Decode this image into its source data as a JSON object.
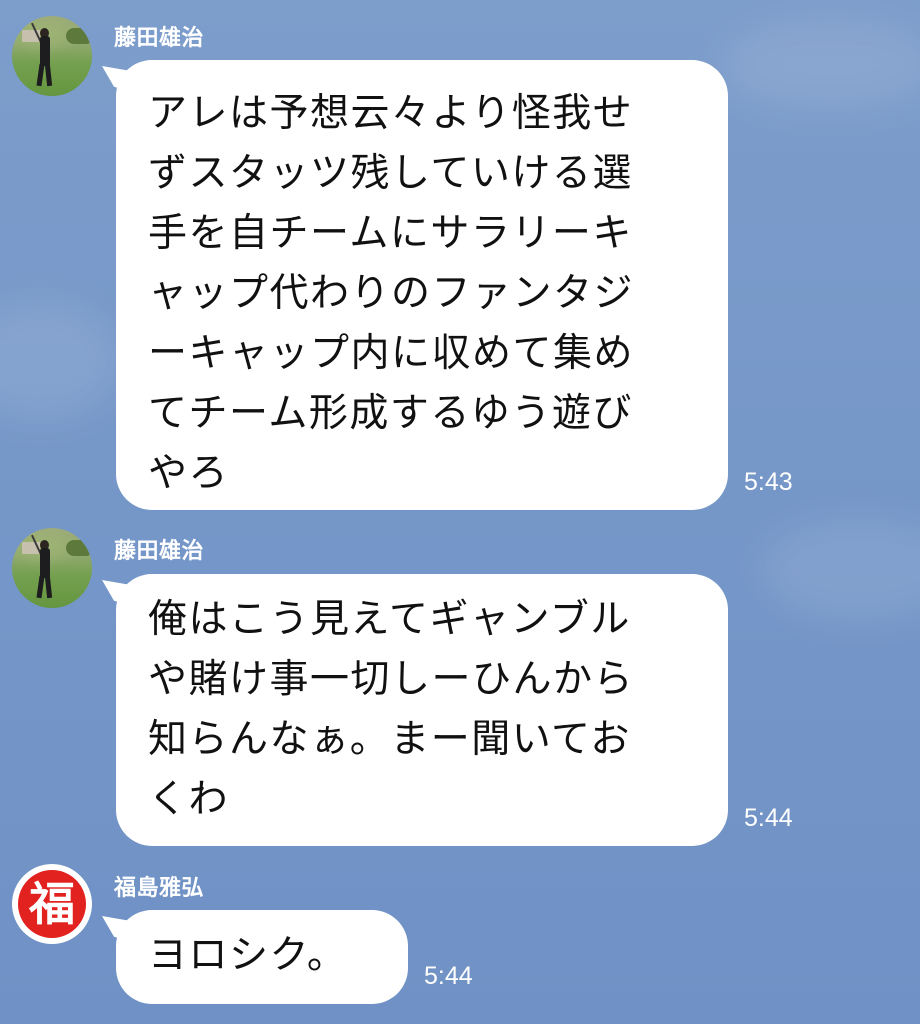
{
  "messages": [
    {
      "sender": "藤田雄治",
      "avatar": "golfer-photo-avatar",
      "lines": [
        "アレは予想云々より怪我せ",
        "ずスタッツ残していける選",
        "手を自チームにサラリーキ",
        "ャップ代わりのファンタジ",
        "ーキャップ内に収めて集め",
        "てチーム形成するゆう遊び",
        "やろ"
      ],
      "time": "5:43"
    },
    {
      "sender": "藤田雄治",
      "avatar": "golfer-photo-avatar",
      "lines": [
        "俺はこう見えてギャンブル",
        "や賭け事一切しーひんから",
        "知らんなぁ。まー聞いてお",
        "くわ"
      ],
      "time": "5:44"
    },
    {
      "sender": "福島雅弘",
      "avatar": "fuku-logo-avatar",
      "avatar_glyph": "福",
      "lines": [
        "ヨロシク。"
      ],
      "time": "5:44"
    }
  ],
  "colors": {
    "background": "#7597c8",
    "bubble": "#ffffff",
    "text": "#111111",
    "meta_text": "#ffffff",
    "fuku_red": "#e1221f"
  }
}
